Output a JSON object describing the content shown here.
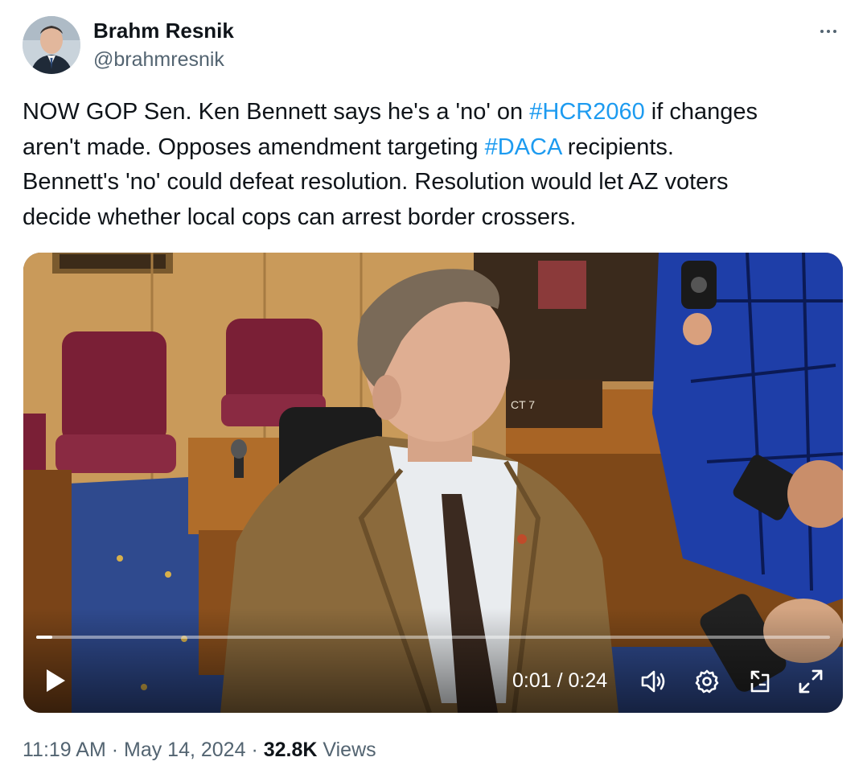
{
  "author": {
    "name": "Brahm Resnik",
    "handle": "@brahmresnik"
  },
  "tweet": {
    "text_lines": [
      [
        {
          "text": "NOW GOP Sen. Ken Bennett says he's a 'no' on ",
          "type": "text"
        },
        {
          "text": "#HCR2060",
          "type": "hashtag"
        },
        {
          "text": " if changes",
          "type": "text"
        }
      ],
      [
        {
          "text": "aren't made. Opposes amendment targeting ",
          "type": "text"
        },
        {
          "text": "#DACA",
          "type": "hashtag"
        },
        {
          "text": " recipients.",
          "type": "text"
        }
      ],
      [
        {
          "text": "Bennett's 'no' could defeat resolution. Resolution would let AZ voters",
          "type": "text"
        }
      ],
      [
        {
          "text": "decide whether local cops can arrest border crossers.",
          "type": "text"
        }
      ]
    ]
  },
  "video": {
    "current_time": "0:01",
    "separator": " / ",
    "duration": "0:24",
    "progress_fraction": 0.02,
    "icons": {
      "play": "play-icon",
      "volume": "volume-icon",
      "settings": "gear-icon",
      "pip": "picture-in-picture-icon",
      "fullscreen": "expand-icon"
    }
  },
  "meta": {
    "time": "11:19 AM",
    "dot1": " · ",
    "date": "May 14, 2024",
    "dot2": " · ",
    "views_count": "32.8K",
    "views_label": " Views"
  },
  "colors": {
    "hashtag": "#1d9bf0",
    "secondary_text": "#536471",
    "primary_text": "#0f1419"
  }
}
